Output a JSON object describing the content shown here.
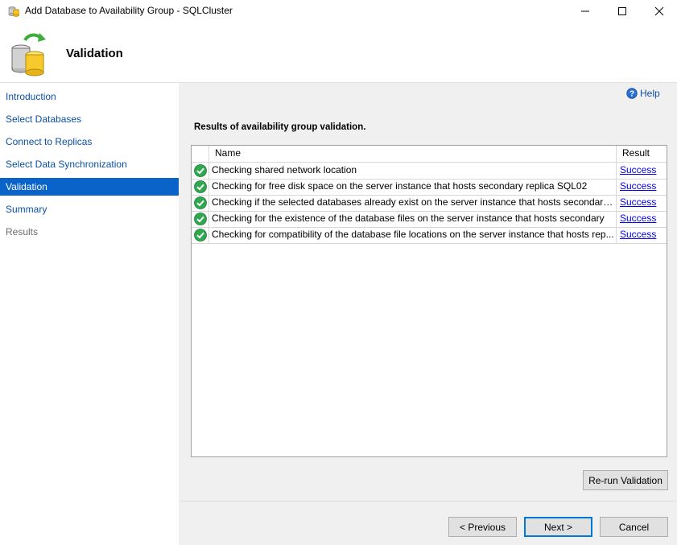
{
  "window": {
    "title": "Add Database to Availability Group - SQLCluster",
    "minimize_glyph": "—",
    "maximize_glyph": "☐",
    "close_glyph": "✕"
  },
  "header": {
    "title": "Validation",
    "icon": "database-refresh-icon"
  },
  "sidebar": {
    "items": [
      {
        "label": "Introduction",
        "state": "link"
      },
      {
        "label": "Select Databases",
        "state": "link"
      },
      {
        "label": "Connect to Replicas",
        "state": "link"
      },
      {
        "label": "Select Data Synchronization",
        "state": "link"
      },
      {
        "label": "Validation",
        "state": "selected"
      },
      {
        "label": "Summary",
        "state": "link"
      },
      {
        "label": "Results",
        "state": "disabled"
      }
    ]
  },
  "help": {
    "label": "Help",
    "icon": "help-icon"
  },
  "results": {
    "title": "Results of availability group validation.",
    "columns": {
      "name": "Name",
      "result": "Result"
    },
    "rows": [
      {
        "status_icon": "success-check-icon",
        "name": "Checking shared network location",
        "result": "Success"
      },
      {
        "status_icon": "success-check-icon",
        "name": "Checking for free disk space on the server instance that hosts secondary replica SQL02",
        "result": "Success"
      },
      {
        "status_icon": "success-check-icon",
        "name": "Checking if the selected databases already exist on the server instance that hosts secondary r...",
        "result": "Success"
      },
      {
        "status_icon": "success-check-icon",
        "name": "Checking for the existence of the database files on the server instance that hosts secondary",
        "result": "Success"
      },
      {
        "status_icon": "success-check-icon",
        "name": "Checking for compatibility of the database file locations on the server instance that hosts rep...",
        "result": "Success"
      }
    ]
  },
  "buttons": {
    "rerun": "Re-run Validation",
    "previous": "< Previous",
    "next": "Next >",
    "cancel": "Cancel"
  },
  "colors": {
    "accent": "#0a63c9",
    "link": "#0c4fa5",
    "success": "#2fa84f"
  }
}
